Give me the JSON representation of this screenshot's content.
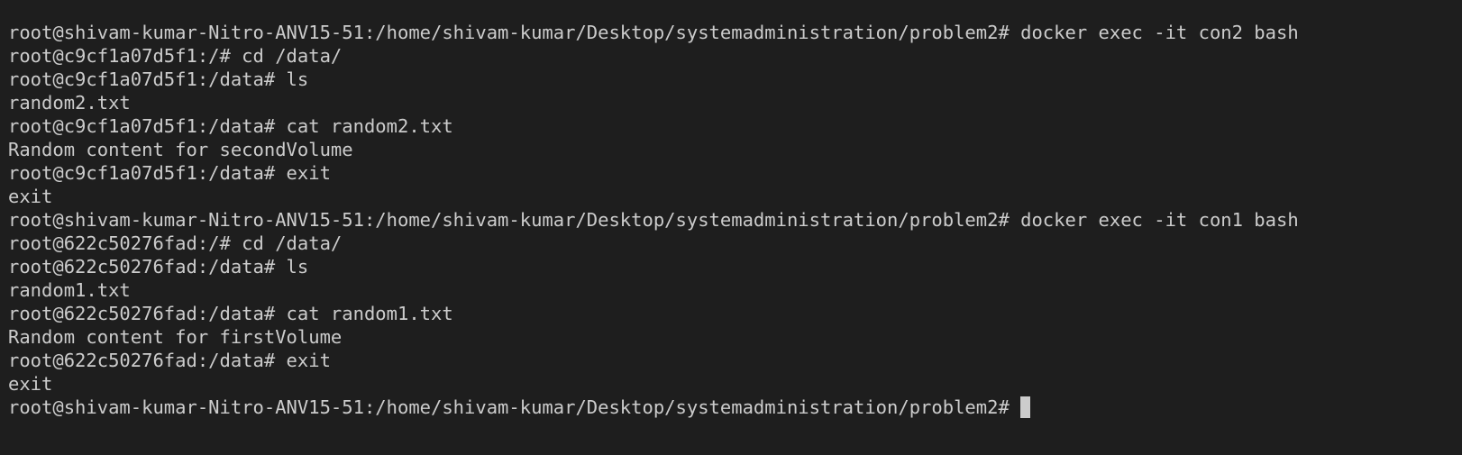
{
  "terminal": {
    "lines": [
      "root@shivam-kumar-Nitro-ANV15-51:/home/shivam-kumar/Desktop/systemadministration/problem2# docker exec -it con2 bash",
      "root@c9cf1a07d5f1:/# cd /data/",
      "root@c9cf1a07d5f1:/data# ls",
      "random2.txt",
      "root@c9cf1a07d5f1:/data# cat random2.txt",
      "Random content for secondVolume",
      "root@c9cf1a07d5f1:/data# exit",
      "exit",
      "root@shivam-kumar-Nitro-ANV15-51:/home/shivam-kumar/Desktop/systemadministration/problem2# docker exec -it con1 bash",
      "root@622c50276fad:/# cd /data/",
      "root@622c50276fad:/data# ls",
      "random1.txt",
      "root@622c50276fad:/data# cat random1.txt",
      "Random content for firstVolume",
      "root@622c50276fad:/data# exit",
      "exit"
    ],
    "prompt": "root@shivam-kumar-Nitro-ANV15-51:/home/shivam-kumar/Desktop/systemadministration/problem2# ",
    "colors": {
      "background": "#1e1e1e",
      "foreground": "#cccccc",
      "cursor": "#cccccc"
    }
  }
}
